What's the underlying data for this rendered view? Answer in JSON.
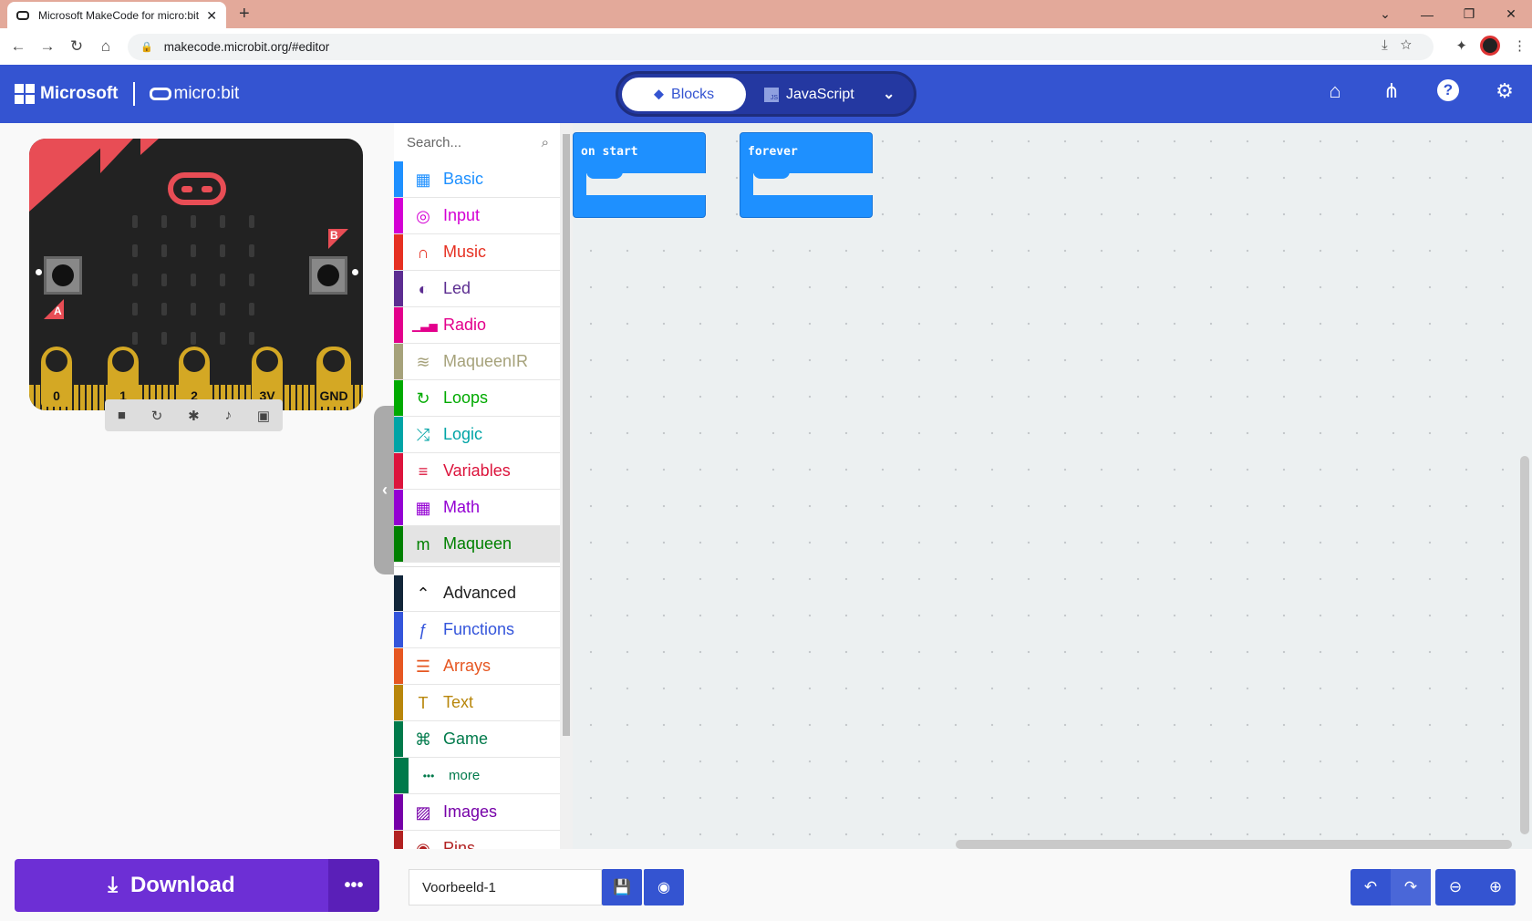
{
  "browser": {
    "tab_title": "Microsoft MakeCode for micro:bit",
    "url": "makecode.microbit.org/#editor"
  },
  "header": {
    "brand": "Microsoft",
    "product": "micro:bit",
    "mode_blocks": "Blocks",
    "mode_javascript": "JavaScript"
  },
  "simulator": {
    "pins": [
      "0",
      "1",
      "2",
      "3V",
      "GND"
    ],
    "button_a": "A",
    "button_b": "B"
  },
  "toolbox": {
    "search_placeholder": "Search...",
    "categories": [
      {
        "label": "Basic",
        "color": "#1e90ff",
        "icon": "grid-icon"
      },
      {
        "label": "Input",
        "color": "#d400d4",
        "icon": "target-icon"
      },
      {
        "label": "Music",
        "color": "#e63022",
        "icon": "headphones-icon"
      },
      {
        "label": "Led",
        "color": "#5c2d91",
        "icon": "toggle-icon"
      },
      {
        "label": "Radio",
        "color": "#e3008c",
        "icon": "signal-bars-icon"
      },
      {
        "label": "MaqueenIR",
        "color": "#a6a27b",
        "icon": "wifi-icon"
      },
      {
        "label": "Loops",
        "color": "#00aa00",
        "icon": "refresh-icon"
      },
      {
        "label": "Logic",
        "color": "#00a4a6",
        "icon": "shuffle-icon"
      },
      {
        "label": "Variables",
        "color": "#dc143c",
        "icon": "list-lines-icon"
      },
      {
        "label": "Math",
        "color": "#9400d3",
        "icon": "calculator-icon"
      },
      {
        "label": "Maqueen",
        "color": "#008000",
        "icon": "m-icon"
      }
    ],
    "advanced_label": "Advanced",
    "advanced_categories": [
      {
        "label": "Functions",
        "color": "#3455db",
        "icon": "fx-icon"
      },
      {
        "label": "Arrays",
        "color": "#e65722",
        "icon": "numbered-list-icon"
      },
      {
        "label": "Text",
        "color": "#b8860b",
        "icon": "text-icon"
      },
      {
        "label": "Game",
        "color": "#007a4b",
        "icon": "gamepad-icon"
      },
      {
        "label": "more",
        "color": "#007a4b",
        "icon": "ellipsis-icon"
      },
      {
        "label": "Images",
        "color": "#7600a8",
        "icon": "image-icon"
      },
      {
        "label": "Pins",
        "color": "#b22222",
        "icon": "pin-target-icon"
      }
    ]
  },
  "workspace": {
    "blocks": [
      {
        "label": "on start"
      },
      {
        "label": "forever"
      }
    ],
    "block_color": "#1e90ff"
  },
  "footer": {
    "download_label": "Download",
    "project_name": "Voorbeeld-1"
  }
}
